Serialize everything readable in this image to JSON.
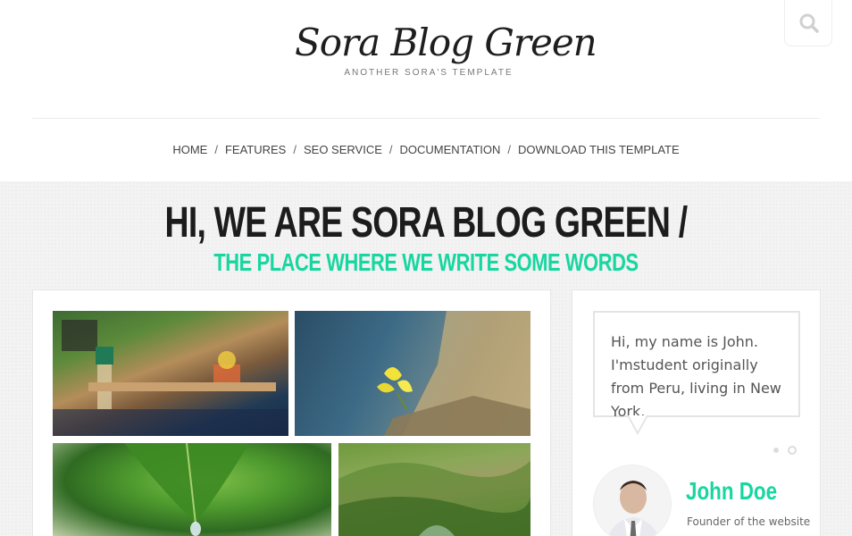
{
  "header": {
    "logo_title": "Sora Blog Green",
    "logo_tagline": "ANOTHER SORA'S TEMPLATE",
    "search_icon": "search-icon"
  },
  "nav": {
    "items": [
      "HOME",
      "FEATURES",
      "SEO SERVICE",
      "DOCUMENTATION",
      "DOWNLOAD THIS TEMPLATE"
    ],
    "separator": "/"
  },
  "hero": {
    "title": "HI, WE ARE SORA BLOG GREEN /",
    "subtitle": "THE PLACE WHERE WE WRITE SOME WORDS"
  },
  "sidebar": {
    "bio": "Hi, my name is John. I'mstudent originally from Peru, living in New York.",
    "name": "John Doe",
    "role": "Founder of the website"
  },
  "colors": {
    "accent": "#17d6a0",
    "heading": "#1c1c1c",
    "hero_bg": "#f3f3f3"
  }
}
